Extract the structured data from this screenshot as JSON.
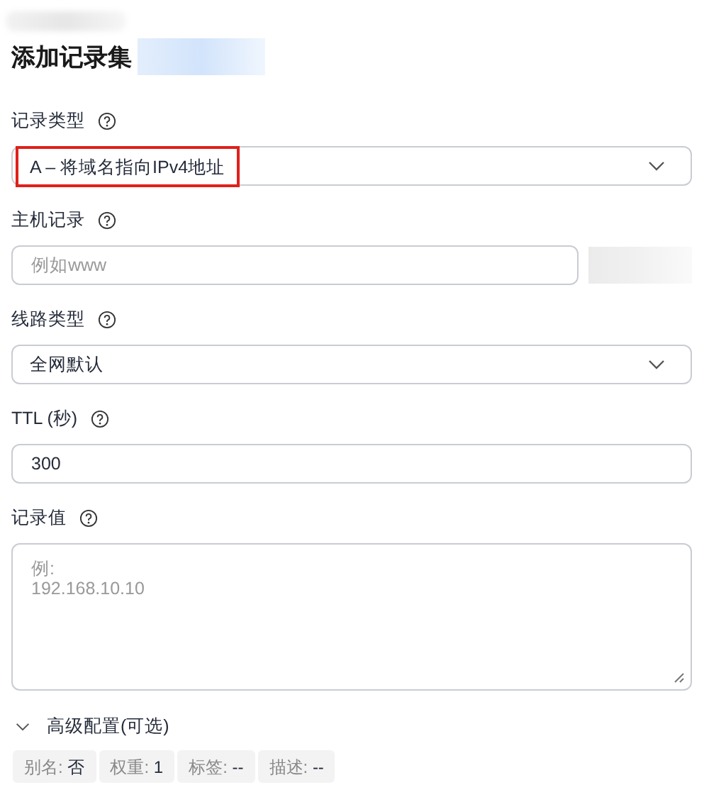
{
  "title": "添加记录集",
  "fields": [
    {
      "kind": "select",
      "label": "记录类型",
      "value": "A – 将域名指向IPv4地址",
      "highlighted": true
    },
    {
      "kind": "input",
      "label": "主机记录",
      "placeholder": "例如www",
      "suffix_blurred": true
    },
    {
      "kind": "select",
      "label": "线路类型",
      "value": "全网默认",
      "highlighted": false
    },
    {
      "kind": "input",
      "label": "TTL (秒)",
      "value": "300",
      "suffix_blurred": false
    },
    {
      "kind": "textarea",
      "label": "记录值",
      "placeholder": "例:\n192.168.10.10"
    }
  ],
  "advanced": {
    "label": "高级配置(可选)",
    "expanded": false
  },
  "tags": [
    {
      "name": "别名:",
      "value": "否"
    },
    {
      "name": "权重:",
      "value": "1"
    },
    {
      "name": "标签:",
      "value": "--"
    },
    {
      "name": "描述:",
      "value": "--"
    }
  ]
}
